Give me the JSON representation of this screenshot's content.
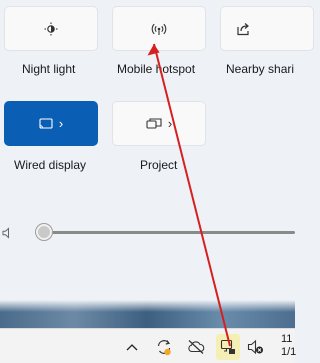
{
  "quick_settings": {
    "row1": [
      {
        "label": "Night light",
        "icon": "night-light-icon",
        "active": false
      },
      {
        "label": "Mobile hotspot",
        "icon": "hotspot-icon",
        "active": false
      },
      {
        "label": "Nearby shari",
        "icon": "share-icon",
        "active": false
      }
    ],
    "row2": [
      {
        "label": "Wired display",
        "icon": "cast-icon",
        "active": true
      },
      {
        "label": "Project",
        "icon": "project-icon",
        "active": false
      }
    ],
    "volume": {
      "level": 0,
      "icon": "speaker-icon"
    }
  },
  "taskbar": {
    "items": [
      "chevron-up-icon",
      "sync-icon",
      "cloud-off-icon",
      "wired-display-icon",
      "speaker-muted-icon"
    ],
    "clock_time": "11",
    "clock_date": "1/1"
  },
  "colors": {
    "accent": "#0a5fb4",
    "annotation_arrow": "#d62020",
    "highlight": "#f6efb5"
  }
}
